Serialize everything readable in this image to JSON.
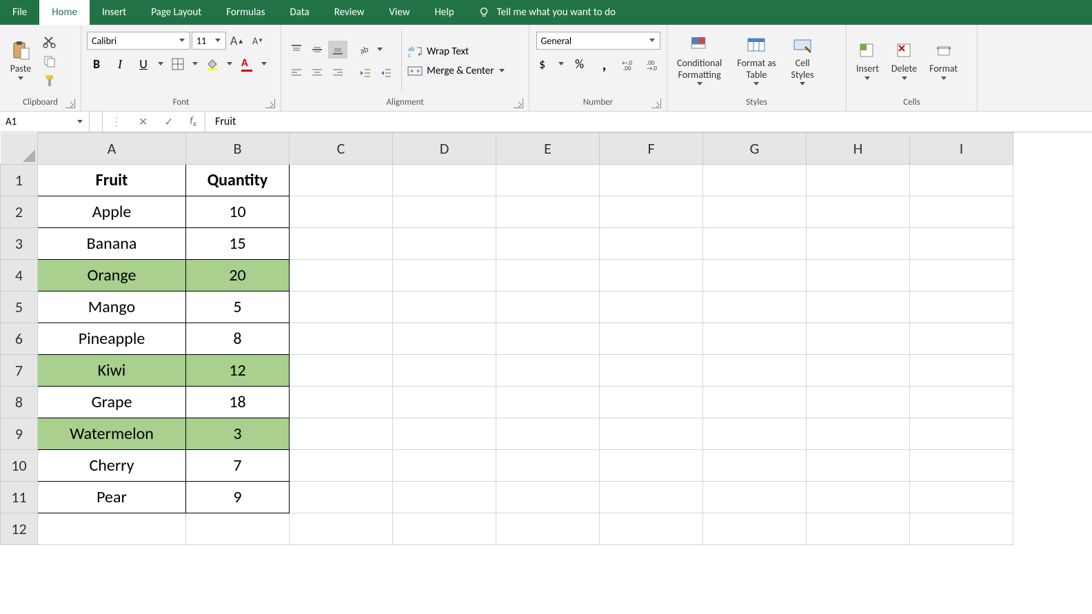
{
  "menu": {
    "tabs": [
      "File",
      "Home",
      "Insert",
      "Page Layout",
      "Formulas",
      "Data",
      "Review",
      "View",
      "Help"
    ],
    "active": 1,
    "tellme": "Tell me what you want to do"
  },
  "ribbon": {
    "clipboard": {
      "label": "Clipboard",
      "paste": "Paste"
    },
    "font": {
      "label": "Font",
      "name": "Calibri",
      "size": "11"
    },
    "alignment": {
      "label": "Alignment",
      "wrap": "Wrap Text",
      "merge": "Merge & Center"
    },
    "number": {
      "label": "Number",
      "format": "General"
    },
    "styles": {
      "label": "Styles",
      "cond": "Conditional\nFormatting",
      "table": "Format as\nTable",
      "cell": "Cell\nStyles"
    },
    "cells": {
      "label": "Cells",
      "insert": "Insert",
      "delete": "Delete",
      "format": "Format"
    }
  },
  "formula_bar": {
    "name": "A1",
    "value": "Fruit"
  },
  "grid": {
    "columns": [
      "A",
      "B",
      "C",
      "D",
      "E",
      "F",
      "G",
      "H",
      "I"
    ],
    "row_count": 12,
    "headers": [
      "Fruit",
      "Quantity"
    ],
    "rows": [
      {
        "fruit": "Apple",
        "qty": "10",
        "hl": false
      },
      {
        "fruit": "Banana",
        "qty": "15",
        "hl": false
      },
      {
        "fruit": "Orange",
        "qty": "20",
        "hl": true
      },
      {
        "fruit": "Mango",
        "qty": "5",
        "hl": false
      },
      {
        "fruit": "Pineapple",
        "qty": "8",
        "hl": false
      },
      {
        "fruit": "Kiwi",
        "qty": "12",
        "hl": true
      },
      {
        "fruit": "Grape",
        "qty": "18",
        "hl": false
      },
      {
        "fruit": "Watermelon",
        "qty": "3",
        "hl": true
      },
      {
        "fruit": "Cherry",
        "qty": "7",
        "hl": false
      },
      {
        "fruit": "Pear",
        "qty": "9",
        "hl": false
      }
    ]
  }
}
